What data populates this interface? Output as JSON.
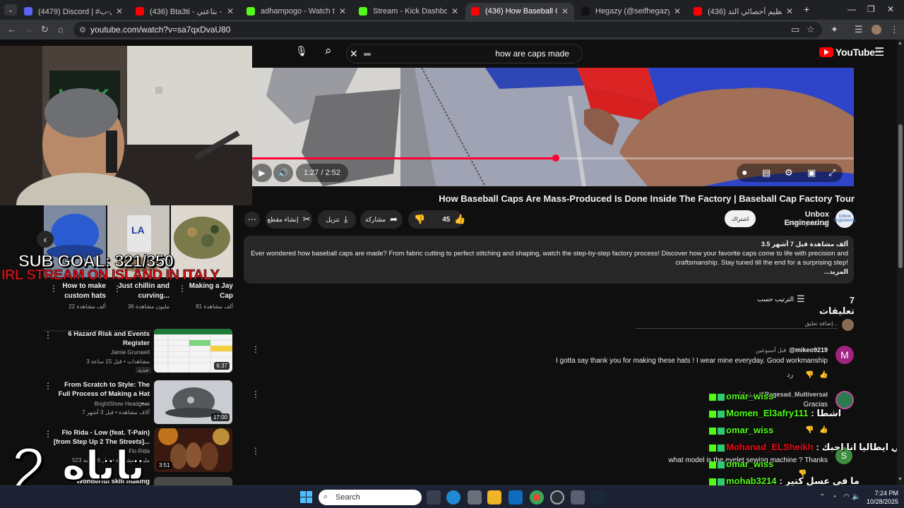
{
  "browser": {
    "tabs": [
      {
        "title": "(4479) Discord | #كوميونتي-ب",
        "favicon_color": "#5865f2",
        "active": false
      },
      {
        "title": "(436) Bta3ti - بتاعتي - YouTube",
        "favicon_color": "#ff0000",
        "active": false
      },
      {
        "title": "adhampogo - Watch the VOD",
        "favicon_color": "#53fc18",
        "active": false
      },
      {
        "title": "Stream - Kick Dashboard",
        "favicon_color": "#53fc18",
        "active": false
      },
      {
        "title": "(436) How Baseball Caps Are M",
        "favicon_color": "#ff0000",
        "active": true
      },
      {
        "title": "Hegazy (@seifhegazy_) | TikTok",
        "favicon_color": "#111111",
        "active": false
      },
      {
        "title": "(436) حسام باعظيم أحصائي التد",
        "favicon_color": "#ff0000",
        "active": false
      }
    ],
    "new_tab": "+",
    "url": "youtube.com/watch?v=sa7qxDvaU80"
  },
  "youtube": {
    "search_query": "how are caps made",
    "logo_text": "YouTube",
    "logo_region": "EG",
    "player": {
      "time": "1:27 / 2:52",
      "progress_fraction": 0.505
    },
    "video_title": "How Baseball Caps Are Mass-Produced Is Done Inside The Factory | Baseball Cap Factory Tour",
    "actions": {
      "likes": "45",
      "share": "مشاركة",
      "download": "تنزيل",
      "clip": "إنشاء مقطع"
    },
    "channel": {
      "name": "Unbox Engineering",
      "subs": "65.5 ألف مشترك",
      "subscribe": "اشتراك",
      "avatar_text": "Unbox Engineering"
    },
    "description": {
      "meta": "3.5 ألف مشاهدة  قبل 7 أشهر",
      "text": "Ever wondered how baseball caps are made? From fabric cutting to perfect stitching and shaping, watch the step-by-step factory process! Discover how your favorite caps come to life with precision and craftsmanship. Stay tuned till the end for a surprising step!",
      "more": "...المزيد"
    },
    "comments": {
      "count": "7 تعليقات",
      "sort": "الترتيب حسب",
      "add_placeholder": "إضافة تعليق...",
      "items": [
        {
          "user": "@mikeo9219",
          "when": "قبل أسبوعين",
          "text": "I gotta say thank you for making these hats ! I wear mine everyday. Good workmanship",
          "reply": "رد",
          "avatar_letter": "M",
          "avatar_color": "#a0237f"
        },
        {
          "user": "@Ragesad_Multiversal",
          "when": "قبل 7 أشهر",
          "text": "Gracias",
          "reply": "رد",
          "avatar_letter": "",
          "avatar_color": "#2a7b4f"
        },
        {
          "user": "",
          "when": "",
          "text": "what model is the eyelet sewing machine ? Thanks",
          "reply": "رد",
          "avatar_letter": "S",
          "avatar_color": "#3e8e41"
        }
      ]
    },
    "recommendations": [
      {
        "title": "6 Hazard Risk and Events Register",
        "channel": "Jamie Grunwell",
        "meta": "3 مشاهدات • قبل 15 ساعة",
        "badge": "جديد",
        "duration": "6:37"
      },
      {
        "title": "From Scratch to Style: The Full Process of Making a Hat –...",
        "channel": "BrightShow Headgear",
        "meta": "7 آلاف مشاهدة • قبل 3 أشهر",
        "badge": "",
        "duration": "17:00"
      },
      {
        "title": "Flo Rida - Low (feat. T-Pain) [from Step Up 2 The Streets]...",
        "channel": "Flo Rida",
        "meta": "523 مليون مشاهدة • قبل 16 سنة",
        "badge": "",
        "duration": "3:51"
      },
      {
        "title": "Wonderful skill making baseball...",
        "channel": "",
        "meta": "",
        "badge": "",
        "duration": ""
      }
    ],
    "shorts": [
      {
        "title": "How to make custom hats",
        "views": "22 ألف مشاهدة"
      },
      {
        "title": "Just chillin and curving...",
        "views": "36 مليون مشاهدة"
      },
      {
        "title": "Making a Jay Cap",
        "views": "81 ألف مشاهدة"
      }
    ]
  },
  "stream_overlay": {
    "sub_goal": "SUB GOAL: 321/350",
    "irl_banner": "IRL STREAM ON ISLAND IN ITALY",
    "big_number": "2",
    "big_arabic": "تاتاه",
    "chat": [
      {
        "user": "omar_wiss",
        "msg": "",
        "color": "#53fc18"
      },
      {
        "user": "Momen_El3afry111",
        "msg": ": اشطا",
        "color": "#53fc18"
      },
      {
        "user": "omar_wiss",
        "msg": "",
        "color": "#53fc18"
      },
      {
        "user": "Mohanad_ELSheikh",
        "msg": ": انت فين في ايطاليا انا احبك",
        "color": "#e3101a"
      },
      {
        "user": "omar_wiss",
        "msg": "",
        "color": "#53fc18"
      },
      {
        "user": "mohab3214",
        "msg": ": ما في عسل كتير",
        "color": "#53fc18"
      },
      {
        "user": "mohab3214",
        "msg": ": ما في عسل كتير",
        "color": "#53fc18"
      }
    ]
  },
  "taskbar": {
    "search": "Search",
    "time": "7:24 PM",
    "date": "10/28/2025"
  }
}
